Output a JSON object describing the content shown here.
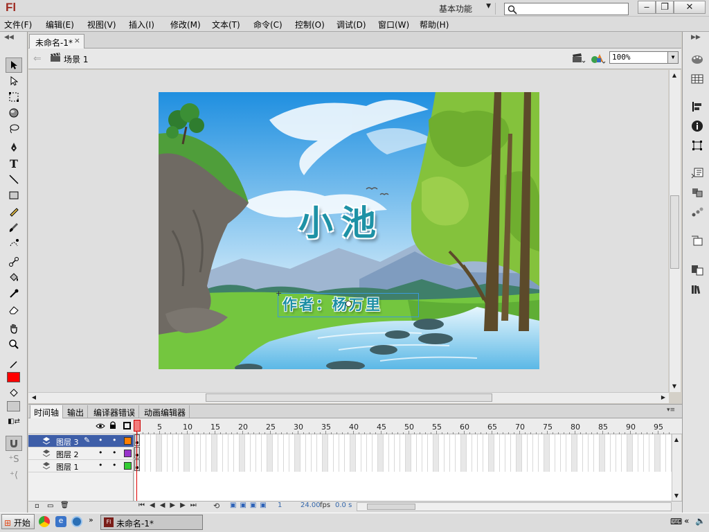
{
  "app": {
    "logo": "Fl",
    "workspace": "基本功能",
    "search_value": ""
  },
  "menu": [
    "文件(F)",
    "编辑(E)",
    "视图(V)",
    "插入(I)",
    "修改(M)",
    "文本(T)",
    "命令(C)",
    "控制(O)",
    "调试(D)",
    "窗口(W)",
    "帮助(H)"
  ],
  "document": {
    "tab_title": "未命名-1*",
    "scene": "场景 1",
    "zoom": "100%"
  },
  "stage": {
    "title": "小池",
    "author": "作者：杨万里"
  },
  "timeline": {
    "tabs": [
      "时间轴",
      "输出",
      "编译器错误",
      "动画编辑器"
    ],
    "frame_numbers": [
      "1",
      "5",
      "10",
      "15",
      "20",
      "25",
      "30",
      "35",
      "40",
      "45",
      "50",
      "55",
      "60",
      "65",
      "70",
      "75",
      "80",
      "85",
      "90",
      "95"
    ],
    "layers": [
      {
        "name": "图层 3",
        "color": "#ff7f00",
        "selected": true
      },
      {
        "name": "图层 2",
        "color": "#9933cc",
        "selected": false
      },
      {
        "name": "图层 1",
        "color": "#33cc33",
        "selected": false
      }
    ],
    "current_frame": "1",
    "fps": "24.00",
    "fps_unit": "fps",
    "time": "0.0 s"
  },
  "colors": {
    "stroke": "#000000",
    "fill": "#ff0000",
    "layer_selected": "#3e5ea8"
  },
  "taskbar": {
    "start": "开始",
    "task": "未命名-1*"
  }
}
